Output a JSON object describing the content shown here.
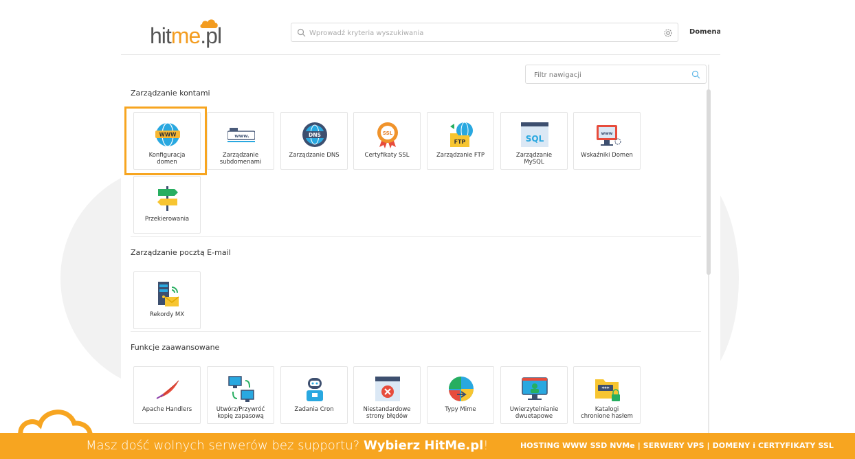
{
  "header": {
    "logo_main": "hit",
    "logo_accent": "me",
    "logo_suffix": ".pl",
    "search_placeholder": "Wprowadź kryteria wyszukiwania",
    "domain_label": "Domena"
  },
  "filter": {
    "placeholder": "Filtr nawigacji"
  },
  "sections": {
    "accounts": {
      "title": "Zarządzanie kontami",
      "tiles": [
        {
          "label": "Konfiguracja\ndomen",
          "icon": "globe-www-icon"
        },
        {
          "label": "Zarządzanie\nsubdomenami",
          "icon": "subdomain-icon"
        },
        {
          "label": "Zarządzanie DNS",
          "icon": "dns-globe-icon"
        },
        {
          "label": "Certyfikaty SSL",
          "icon": "ssl-badge-icon"
        },
        {
          "label": "Zarządzanie FTP",
          "icon": "ftp-folder-icon"
        },
        {
          "label": "Zarządzanie\nMySQL",
          "icon": "sql-database-icon"
        },
        {
          "label": "Wskaźniki Domen",
          "icon": "domain-monitor-icon"
        },
        {
          "label": "Przekierowania",
          "icon": "signpost-icon"
        }
      ]
    },
    "email": {
      "title": "Zarządzanie pocztą E-mail",
      "tiles": [
        {
          "label": "Rekordy MX",
          "icon": "mx-server-mail-icon"
        }
      ]
    },
    "advanced": {
      "title": "Funkcje zaawansowane",
      "tiles": [
        {
          "label": "Apache Handlers",
          "icon": "apache-feather-icon"
        },
        {
          "label": "Utwórz/Przywróć\nkopię zapasową",
          "icon": "backup-computers-icon"
        },
        {
          "label": "Zadania Cron",
          "icon": "cron-robot-icon"
        },
        {
          "label": "Niestandardowe\nstrony błędów",
          "icon": "error-page-icon"
        },
        {
          "label": "Typy Mime",
          "icon": "mime-types-icon"
        },
        {
          "label": "Uwierzytelnianie\ndwuetapowe",
          "icon": "two-factor-monitor-icon"
        },
        {
          "label": "Katalogi\nchronione hasłem",
          "icon": "locked-folder-icon"
        }
      ]
    }
  },
  "banner": {
    "left_text": "Masz dość wolnych serwerów bez supportu?",
    "left_bold": "Wybierz HitMe.pl",
    "left_end": "!",
    "right_text": "HOSTING WWW SSD NVMe | SERWERY VPS | DOMENY i CERTYFIKATY SSL"
  },
  "colors": {
    "brand_orange": "#f7a520",
    "highlight": "#f7a520"
  }
}
